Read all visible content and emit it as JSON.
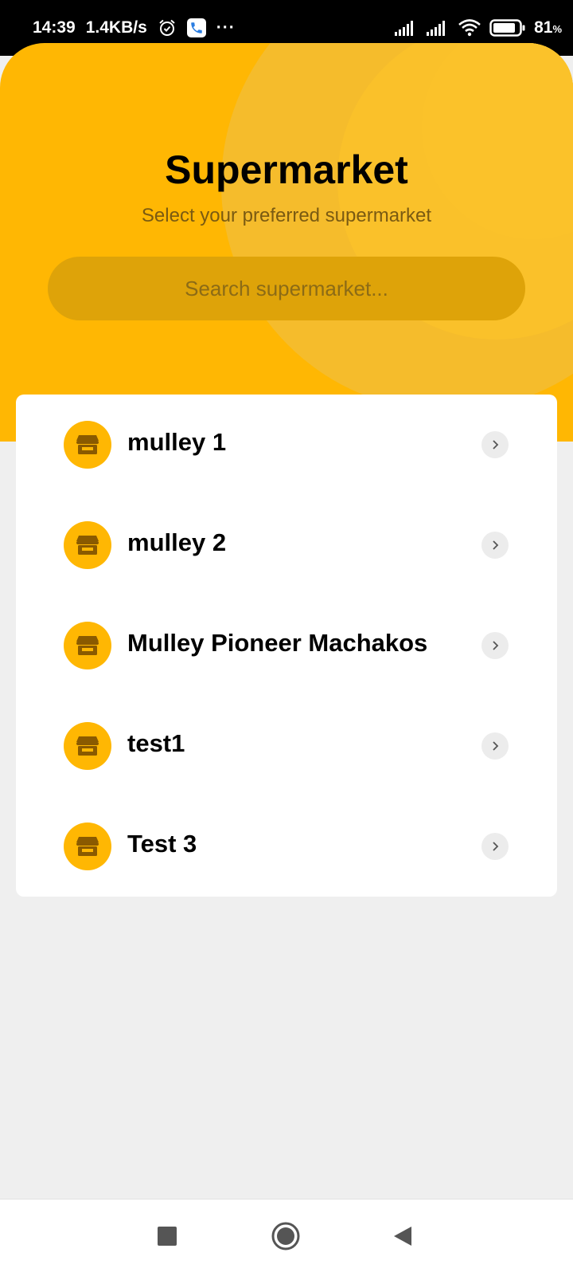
{
  "status_bar": {
    "time": "14:39",
    "speed": "1.4KB/s",
    "more": "···",
    "battery_percent": "81",
    "battery_unit": "%"
  },
  "header": {
    "title": "Supermarket",
    "subtitle": "Select your preferred supermarket"
  },
  "search": {
    "placeholder": "Search supermarket...",
    "value": ""
  },
  "supermarkets": [
    {
      "name": "mulley 1"
    },
    {
      "name": "mulley 2"
    },
    {
      "name": "Mulley Pioneer Machakos"
    },
    {
      "name": "test1"
    },
    {
      "name": "Test 3"
    }
  ],
  "icons": {
    "store": "store-icon",
    "chevron": "chevron-right-icon",
    "nav_recents": "square-icon",
    "nav_home": "circle-icon",
    "nav_back": "back-triangle-icon"
  },
  "colors": {
    "accent": "#ffb703",
    "search_bg": "#dea309",
    "page_bg": "#efefef",
    "card_bg": "#ffffff"
  }
}
